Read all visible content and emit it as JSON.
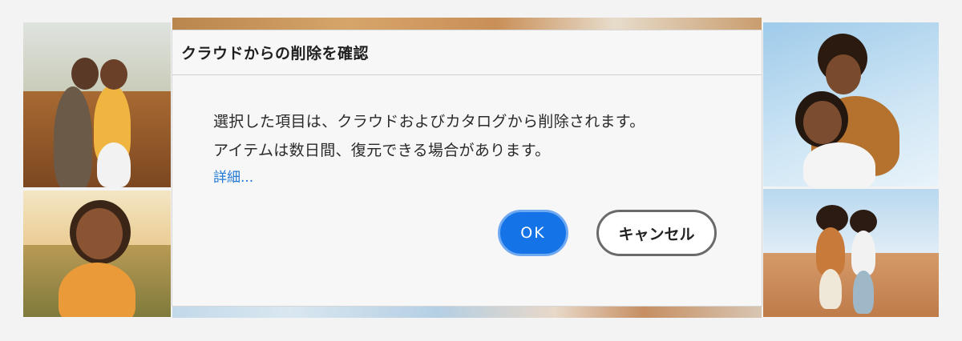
{
  "dialog": {
    "title": "クラウドからの削除を確認",
    "message_line1": "選択した項目は、クラウドおよびカタログから削除されます。",
    "message_line2": "アイテムは数日間、復元できる場合があります。",
    "details_link": "詳細...",
    "ok_label": "OK",
    "cancel_label": "キャンセル"
  },
  "colors": {
    "primary_button": "#1473e6",
    "link": "#2178d6",
    "dialog_background": "#f7f7f7",
    "page_background": "#f3f3f3"
  }
}
